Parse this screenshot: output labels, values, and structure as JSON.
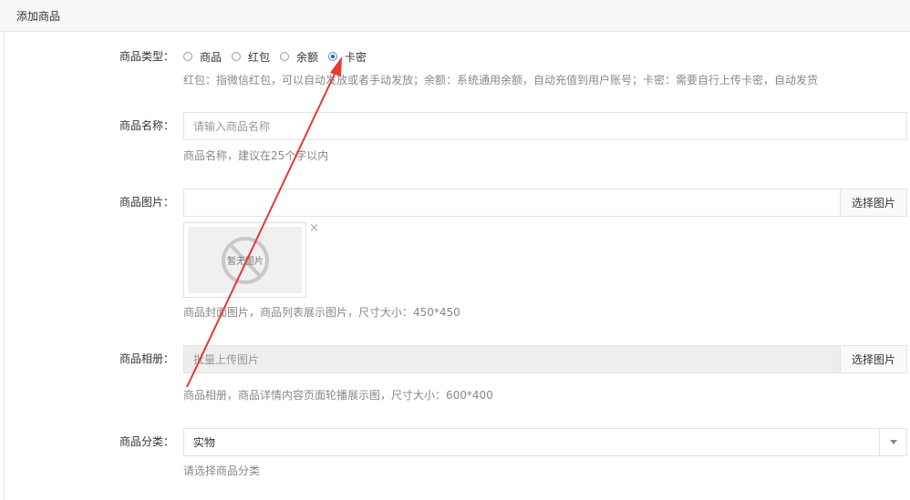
{
  "header": {
    "title": "添加商品"
  },
  "form": {
    "type": {
      "label": "商品类型：",
      "options": [
        "商品",
        "红包",
        "余额",
        "卡密"
      ],
      "selected": "卡密",
      "help": "红包：指微信红包，可以自动发放或者手动发放；余额：系统通用余额，自动充值到用户账号；卡密：需要自行上传卡密，自动发货"
    },
    "name": {
      "label": "商品名称：",
      "placeholder": "请输入商品名称",
      "help": "商品名称，建议在25个字以内"
    },
    "image": {
      "label": "商品图片：",
      "button": "选择图片",
      "preview_text": "暂无图片",
      "close": "×",
      "help": "商品封面图片，商品列表展示图片，尺寸大小：450*450"
    },
    "album": {
      "label": "商品相册：",
      "placeholder": "批量上传图片",
      "button": "选择图片",
      "help": "商品相册，商品详情内容页面轮播展示图，尺寸大小：600*400"
    },
    "category": {
      "label": "商品分类：",
      "value": "实物",
      "help": "请选择商品分类"
    }
  },
  "colors": {
    "annotation_arrow": "#e53935",
    "radio_selected": "#2f5f9f"
  }
}
